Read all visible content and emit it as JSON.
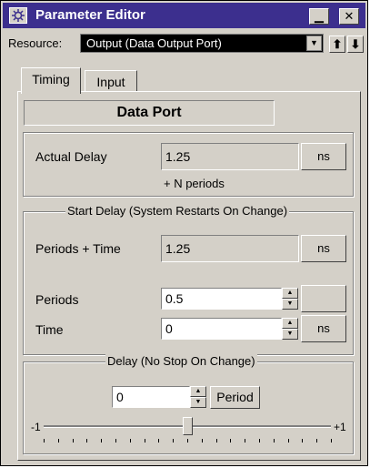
{
  "window": {
    "title": "Parameter Editor",
    "minimize_glyph": "▁",
    "close_glyph": "✕",
    "icon": "settings-gear-icon"
  },
  "resource": {
    "label": "Resource:",
    "value": "Output (Data Output Port)",
    "up_glyph": "⬆",
    "down_glyph": "⬇"
  },
  "tabs": [
    {
      "label": "Timing",
      "active": true
    },
    {
      "label": "Input",
      "active": false
    }
  ],
  "header": "Data Port",
  "actual_delay": {
    "label": "Actual Delay",
    "value": "1.25",
    "unit": "ns",
    "note": "+ N periods"
  },
  "start_delay": {
    "legend": "Start Delay (System Restarts On Change)",
    "periods_time_label": "Periods + Time",
    "periods_time_value": "1.25",
    "periods_time_unit": "ns",
    "periods_label": "Periods",
    "periods_value": "0.5",
    "time_label": "Time",
    "time_value": "0",
    "time_unit": "ns"
  },
  "delay": {
    "legend": "Delay (No Stop On Change)",
    "value": "0",
    "button": "Period",
    "min_label": "-1",
    "max_label": "+1",
    "slider_fraction": 0.5
  },
  "colors": {
    "titlebar": "#3c2f8e",
    "face": "#d4d0c8",
    "combo": "#000000"
  }
}
